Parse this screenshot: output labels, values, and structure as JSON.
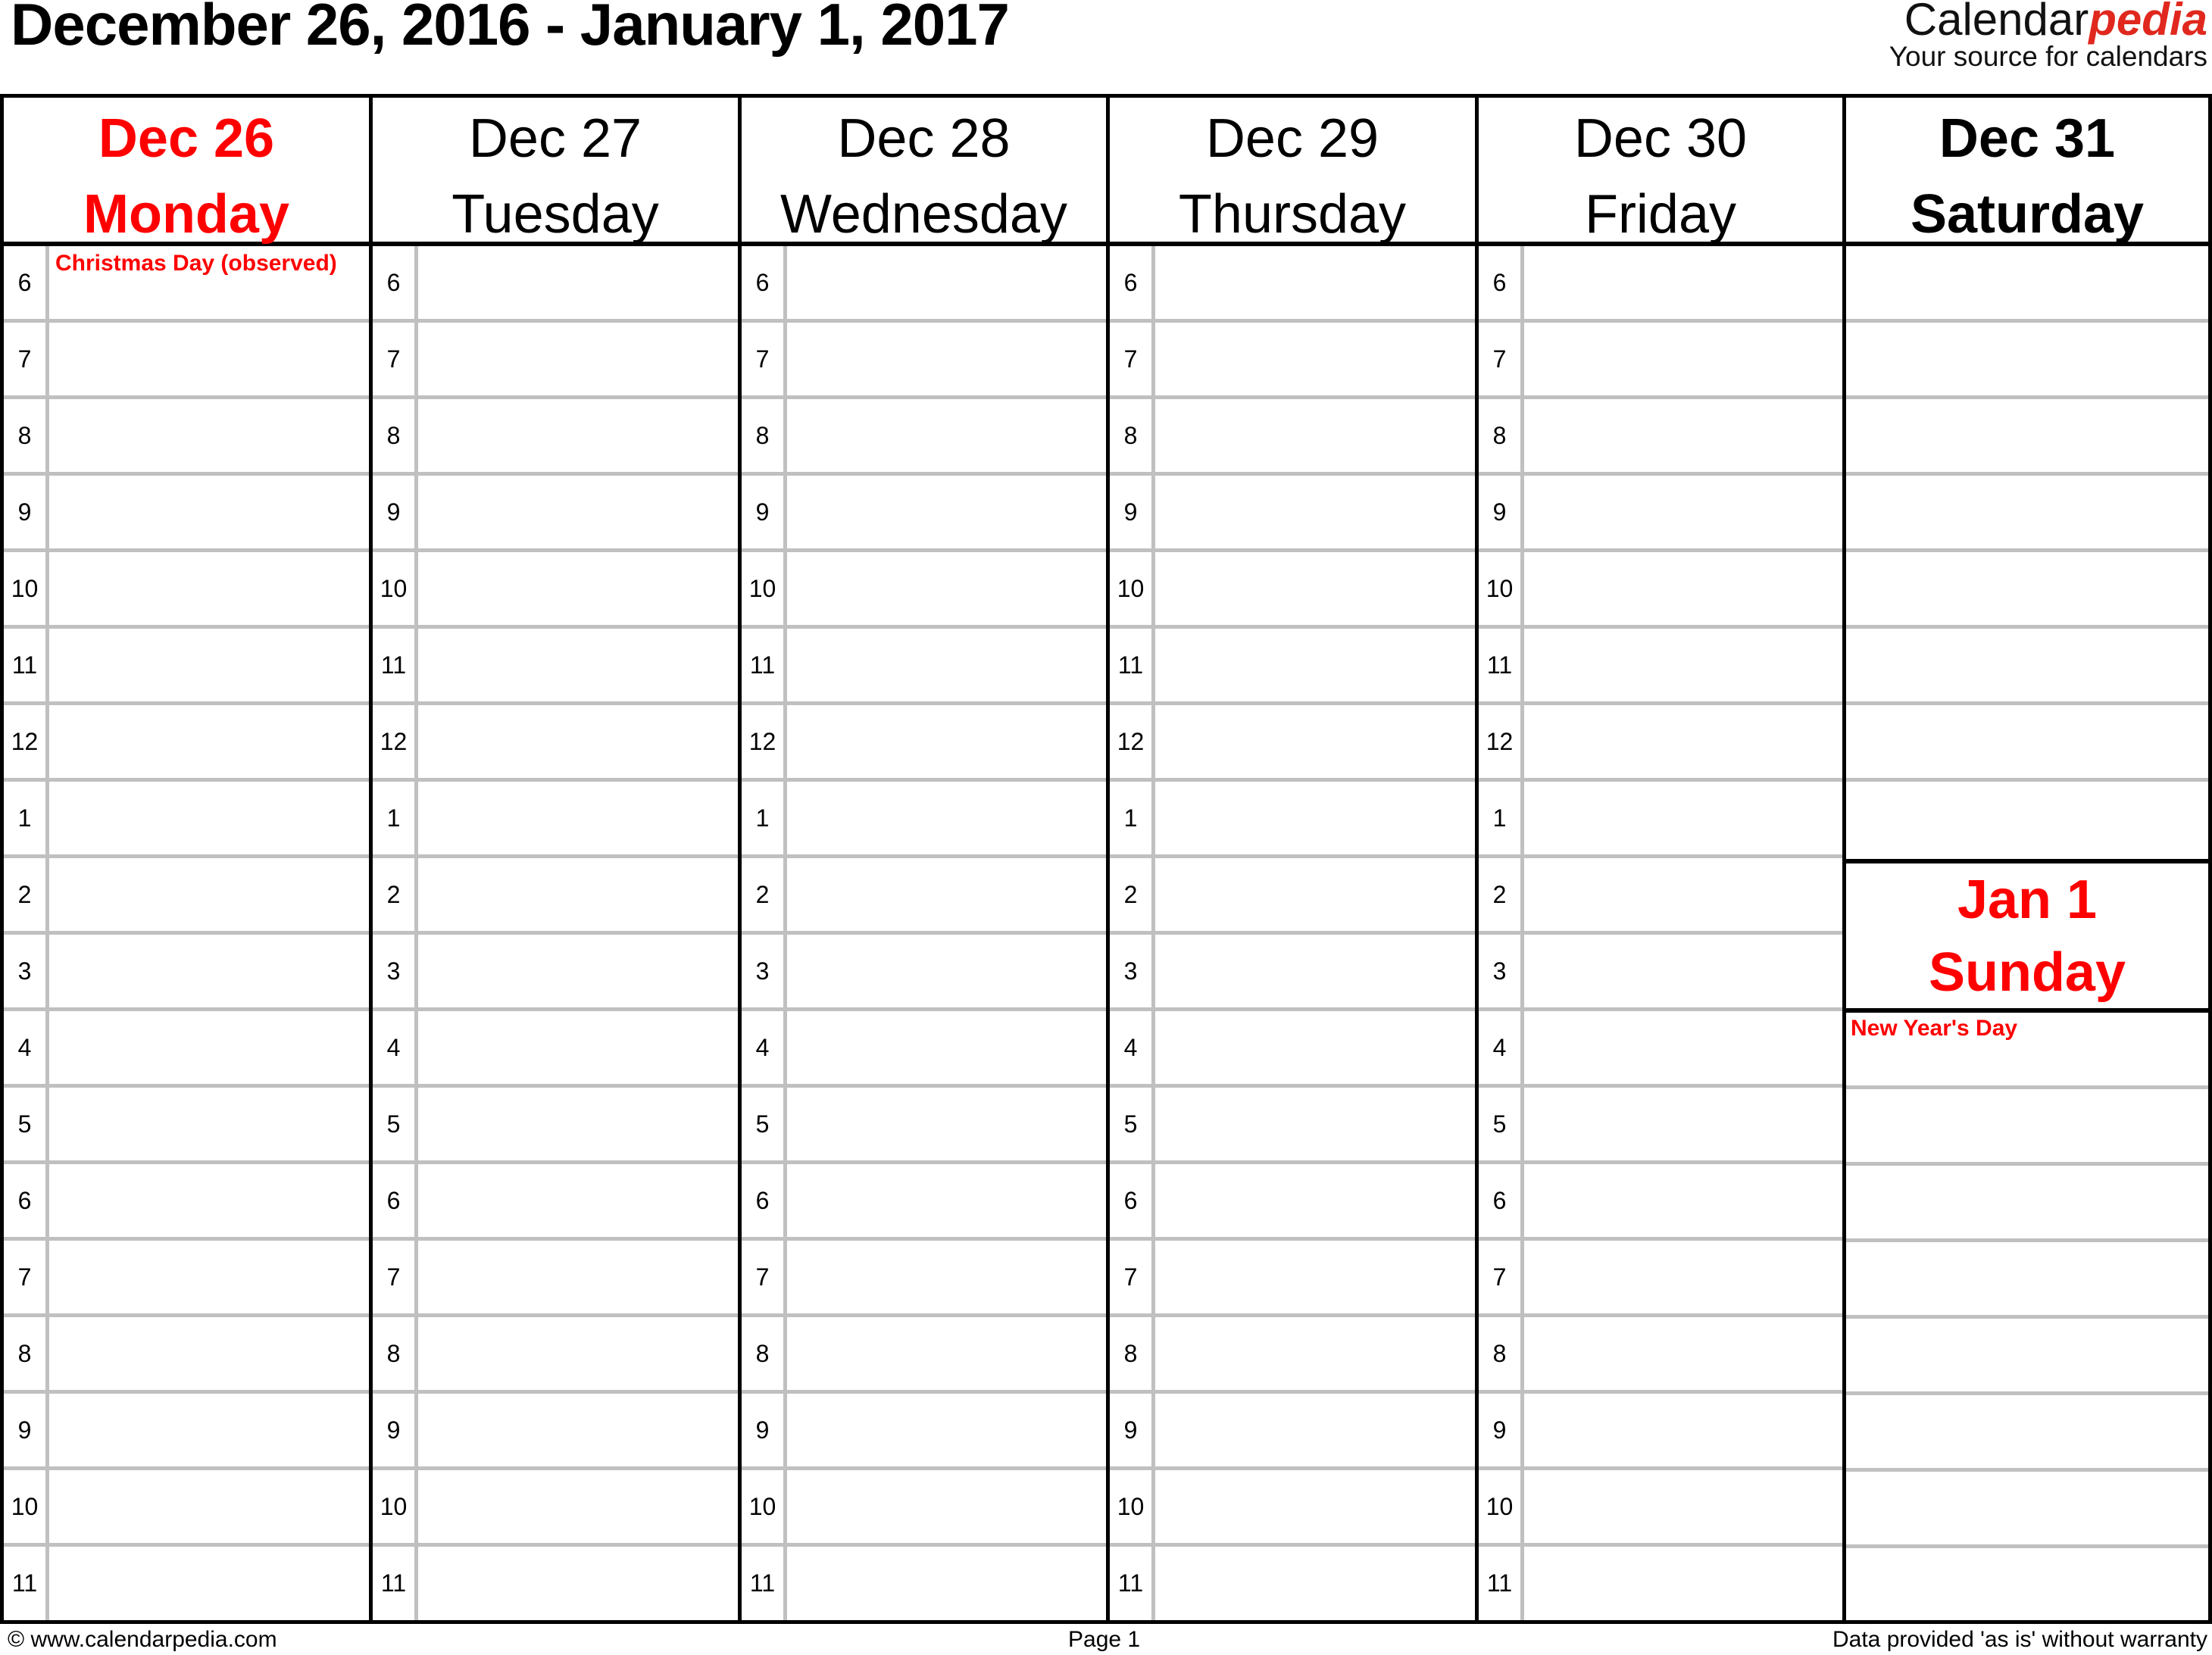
{
  "header": {
    "title": "December 26, 2016 - January 1, 2017",
    "logo_brand": "Calendar",
    "logo_accent": "pedia",
    "logo_tagline": "Your source for calendars"
  },
  "colors": {
    "holiday_red": "#ff0000",
    "logo_red": "#e0281e",
    "grid_gray": "#c0c0c0"
  },
  "hours": [
    "6",
    "7",
    "8",
    "9",
    "10",
    "11",
    "12",
    "1",
    "2",
    "3",
    "4",
    "5",
    "6",
    "7",
    "8",
    "9",
    "10",
    "11"
  ],
  "days": [
    {
      "date": "Dec 26",
      "weekday": "Monday",
      "event": "Christmas Day (observed)"
    },
    {
      "date": "Dec 27",
      "weekday": "Tuesday",
      "event": ""
    },
    {
      "date": "Dec 28",
      "weekday": "Wednesday",
      "event": ""
    },
    {
      "date": "Dec 29",
      "weekday": "Thursday",
      "event": ""
    },
    {
      "date": "Dec 30",
      "weekday": "Friday",
      "event": ""
    }
  ],
  "weekend": {
    "saturday": {
      "date": "Dec 31",
      "weekday": "Saturday"
    },
    "sunday": {
      "date": "Jan 1",
      "weekday": "Sunday",
      "event": "New Year's Day"
    }
  },
  "footer": {
    "left": "© www.calendarpedia.com",
    "center": "Page 1",
    "right": "Data provided 'as is' without warranty"
  }
}
